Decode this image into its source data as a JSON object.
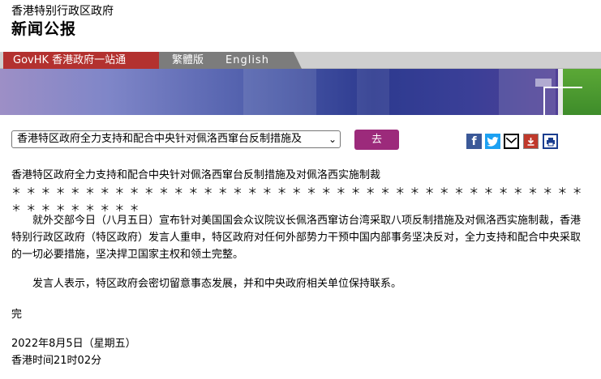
{
  "header": {
    "org": "香港特别行政区政府",
    "title": "新闻公报"
  },
  "nav": {
    "govhk": "GovHK 香港政府一站通",
    "traditional": "繁體版",
    "english": "English"
  },
  "toolbar": {
    "select_value": "香港特区政府全力支持和配合中央针对佩洛西窜台反制措施及",
    "go_label": "去"
  },
  "share_icons": [
    "facebook-icon",
    "twitter-icon",
    "email-icon",
    "download-icon",
    "print-icon"
  ],
  "article": {
    "title": "香港特区政府全力支持和配合中央针对佩洛西窜台反制措施及对佩洛西实施制裁",
    "stars": "＊＊＊＊＊＊＊＊＊＊＊＊＊＊＊＊＊＊＊＊＊＊＊＊＊＊＊＊＊＊＊＊＊＊＊＊＊＊＊＊＊＊＊＊＊＊＊＊",
    "para1": "就外交部今日（八月五日）宣布针对美国国会众议院议长佩洛西窜访台湾采取八项反制措施及对佩洛西实施制裁，香港特别行政区政府（特区政府）发言人重申，特区政府对任何外部势力干预中国内部事务坚决反对，全力支持和配合中央采取的一切必要措施，坚决捍卫国家主权和领土完整。",
    "para2": "发言人表示，特区政府会密切留意事态发展，并和中央政府相关单位保持联系。",
    "end": "完",
    "date": "2022年8月5日（星期五）",
    "time": "香港时间21时02分"
  },
  "colors": {
    "govhk_tab": "#b3312f",
    "go_button": "#9c2a7b",
    "banner_blue": "#2d3a8f"
  }
}
